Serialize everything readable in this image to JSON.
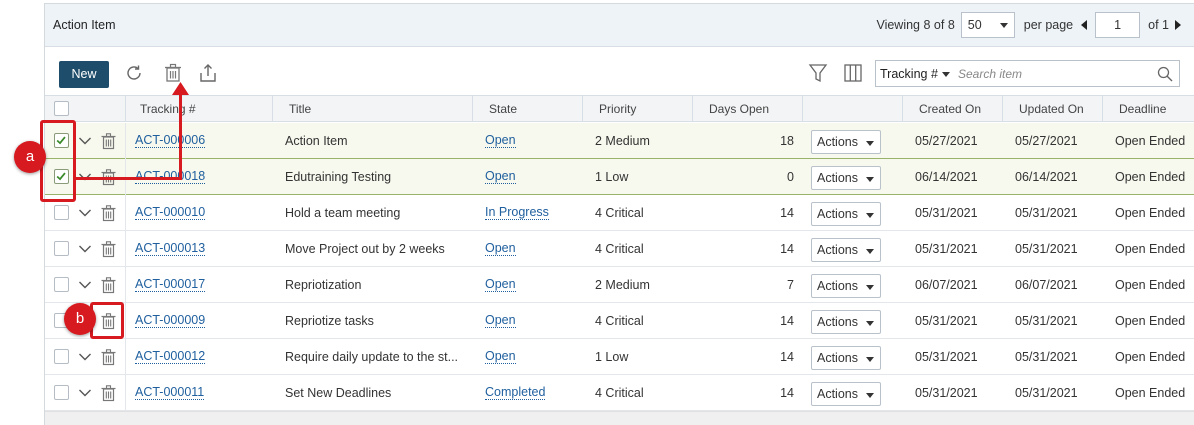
{
  "header": {
    "title": "Action Item",
    "viewing_label": "Viewing",
    "viewing_count": "8 of 8",
    "per_page_value": "50",
    "per_page_label": "per page",
    "page_value": "1",
    "page_of": "of 1"
  },
  "toolbar": {
    "new_label": "New",
    "search_field": "Tracking #",
    "search_placeholder": "Search item"
  },
  "columns": {
    "tracking": "Tracking #",
    "title": "Title",
    "state": "State",
    "priority": "Priority",
    "days_open": "Days Open",
    "created_on": "Created On",
    "updated_on": "Updated On",
    "deadline": "Deadline"
  },
  "rows": [
    {
      "selected": true,
      "tracking": "ACT-000006",
      "title": "Action Item",
      "state": "Open",
      "priority": "2 Medium",
      "days_open": "18",
      "actions": "Actions",
      "created_on": "05/27/2021",
      "updated_on": "05/27/2021",
      "deadline": "Open Ended"
    },
    {
      "selected": true,
      "tracking": "ACT-000018",
      "title": "Edutraining Testing",
      "state": "Open",
      "priority": "1 Low",
      "days_open": "0",
      "actions": "Actions",
      "created_on": "06/14/2021",
      "updated_on": "06/14/2021",
      "deadline": "Open Ended"
    },
    {
      "selected": false,
      "tracking": "ACT-000010",
      "title": "Hold a team meeting",
      "state": "In Progress",
      "priority": "4 Critical",
      "days_open": "14",
      "actions": "Actions",
      "created_on": "05/31/2021",
      "updated_on": "05/31/2021",
      "deadline": "Open Ended"
    },
    {
      "selected": false,
      "tracking": "ACT-000013",
      "title": "Move Project out by 2 weeks",
      "state": "Open",
      "priority": "4 Critical",
      "days_open": "14",
      "actions": "Actions",
      "created_on": "05/31/2021",
      "updated_on": "05/31/2021",
      "deadline": "Open Ended"
    },
    {
      "selected": false,
      "tracking": "ACT-000017",
      "title": "Repriotization",
      "state": "Open",
      "priority": "2 Medium",
      "days_open": "7",
      "actions": "Actions",
      "created_on": "06/07/2021",
      "updated_on": "06/07/2021",
      "deadline": "Open Ended"
    },
    {
      "selected": false,
      "tracking": "ACT-000009",
      "title": "Repriotize tasks",
      "state": "Open",
      "priority": "4 Critical",
      "days_open": "14",
      "actions": "Actions",
      "created_on": "05/31/2021",
      "updated_on": "05/31/2021",
      "deadline": "Open Ended"
    },
    {
      "selected": false,
      "tracking": "ACT-000012",
      "title": "Require daily update to the st...",
      "state": "Open",
      "priority": "1 Low",
      "days_open": "14",
      "actions": "Actions",
      "created_on": "05/31/2021",
      "updated_on": "05/31/2021",
      "deadline": "Open Ended"
    },
    {
      "selected": false,
      "tracking": "ACT-000011",
      "title": "Set New Deadlines",
      "state": "Completed",
      "priority": "4 Critical",
      "days_open": "14",
      "actions": "Actions",
      "created_on": "05/31/2021",
      "updated_on": "05/31/2021",
      "deadline": "Open Ended"
    }
  ],
  "annotations": {
    "a": "a",
    "b": "b"
  },
  "icons": {
    "refresh": "refresh-icon",
    "delete": "trash-icon",
    "export": "export-icon",
    "filter": "filter-icon",
    "columns": "columns-icon",
    "search": "search-icon"
  },
  "colors": {
    "new_button": "#1e4d6b",
    "link": "#1f5f9e",
    "annotation": "#d71920",
    "selected_row": "#f7f9ee",
    "header_bg": "#eef3f8"
  }
}
